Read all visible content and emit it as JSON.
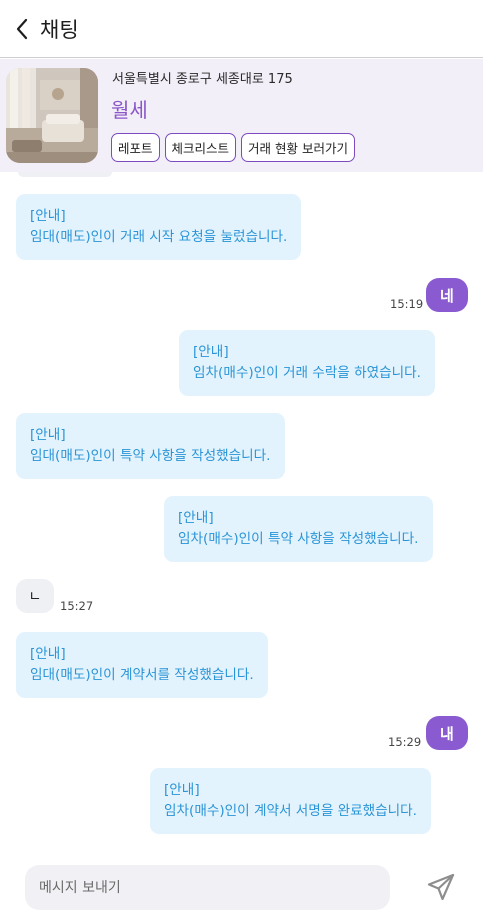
{
  "header": {
    "title": "채팅"
  },
  "property": {
    "address": "서울특별시 종로구 세종대로 175",
    "type": "월세",
    "buttons": [
      "레포트",
      "체크리스트",
      "거래 현황 보러가기"
    ]
  },
  "messages": [
    {
      "kind": "notice",
      "side": "left",
      "title": "[안내]",
      "text": "임대(매도)인이 거래 시작 요청을 눌렀습니다."
    },
    {
      "kind": "me",
      "text": "네",
      "time": "15:19"
    },
    {
      "kind": "notice",
      "side": "right",
      "title": "[안내]",
      "text": "임차(매수)인이 거래 수락을 하였습니다."
    },
    {
      "kind": "notice",
      "side": "left",
      "title": "[안내]",
      "text": "임대(매도)인이 특약 사항을 작성했습니다."
    },
    {
      "kind": "notice",
      "side": "right",
      "title": "[안내]",
      "text": "임차(매수)인이 특약 사항을 작성했습니다."
    },
    {
      "kind": "them",
      "text": "ㄴ",
      "time": "15:27"
    },
    {
      "kind": "notice",
      "side": "left",
      "title": "[안내]",
      "text": "임대(매도)인이 계약서를 작성했습니다."
    },
    {
      "kind": "me",
      "text": "내",
      "time": "15:29"
    },
    {
      "kind": "notice",
      "side": "right",
      "title": "[안내]",
      "text": "임차(매수)인이 계약서 서명을 완료했습니다."
    }
  ],
  "composer": {
    "placeholder": "메시지 보내기"
  },
  "colors": {
    "accent": "#8a5bd0",
    "notice_bg": "#e3f3fd",
    "notice_text": "#2a94d6",
    "header_band": "#f3eff8"
  }
}
